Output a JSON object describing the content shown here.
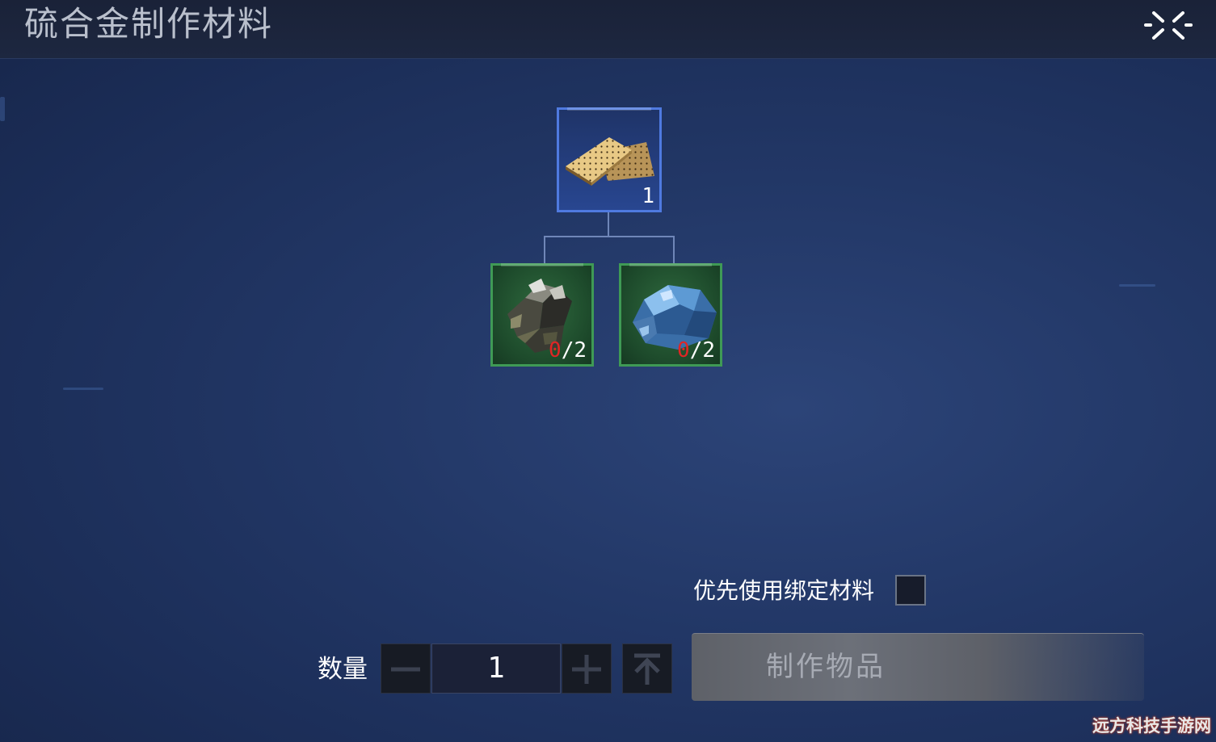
{
  "header": {
    "title": "硫合金制作材料",
    "close_icon": "close-shrink-arrows-icon"
  },
  "recipe": {
    "result": {
      "icon": "alloy-plate-icon",
      "count": "1"
    },
    "materials": [
      {
        "icon": "pyrite-ore-icon",
        "have": "0",
        "need": "/2"
      },
      {
        "icon": "blue-crystal-ore-icon",
        "have": "0",
        "need": "/2"
      }
    ]
  },
  "options": {
    "bind_label": "优先使用绑定材料",
    "bind_checked": false
  },
  "quantity": {
    "label": "数量",
    "value": "1",
    "minus_icon": "minus-icon",
    "plus_icon": "plus-icon",
    "max_icon": "max-arrow-icon"
  },
  "craft": {
    "button_label": "制作物品"
  },
  "watermark": "远方科技手游网",
  "colors": {
    "result_border": "#4f7ae0",
    "material_border": "#3f9a55",
    "missing_count": "#e02525"
  }
}
